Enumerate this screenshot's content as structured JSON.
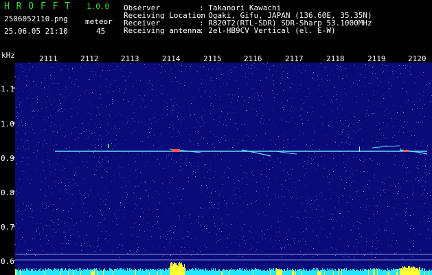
{
  "header": {
    "app_name": "H R O F F T",
    "version": "1.0.0",
    "filename": "2506052110.png",
    "timestamp": "25.06.05 21:10",
    "meteor_label": "meteor",
    "meteor_count": "45",
    "info": [
      {
        "label": "Observer",
        "value": ": Takanori Kawachi"
      },
      {
        "label": "Receiving Location",
        "value": ": Ogaki, Gifu, JAPAN (136.60E, 35.35N)"
      },
      {
        "label": "Receiver",
        "value": ": R820T2(RTL-SDR) SDR-Sharp 53.1000MHz"
      },
      {
        "label": "Receiving antenna",
        "value": ": 2el-HB9CV Vertical (el. E-W)"
      }
    ]
  },
  "axes": {
    "y_unit": "kHz",
    "y_ticks": [
      {
        "label": "1.1",
        "value": 1.1
      },
      {
        "label": "1.0",
        "value": 1.0
      },
      {
        "label": "0.9",
        "value": 0.9
      },
      {
        "label": "0.8",
        "value": 0.8
      },
      {
        "label": "0.7",
        "value": 0.7
      },
      {
        "label": "0.6",
        "value": 0.6
      }
    ],
    "x_ticks": [
      "2111",
      "2112",
      "2113",
      "2114",
      "2115",
      "2116",
      "2117",
      "2118",
      "2119",
      "2120"
    ]
  },
  "colors": {
    "background": "#0a0a78",
    "noise": "#3a6cff",
    "signal_line": "#66e0ff",
    "hot": "#ff5a5a",
    "yellow": "#ffff33",
    "green": "#39e03a"
  }
}
